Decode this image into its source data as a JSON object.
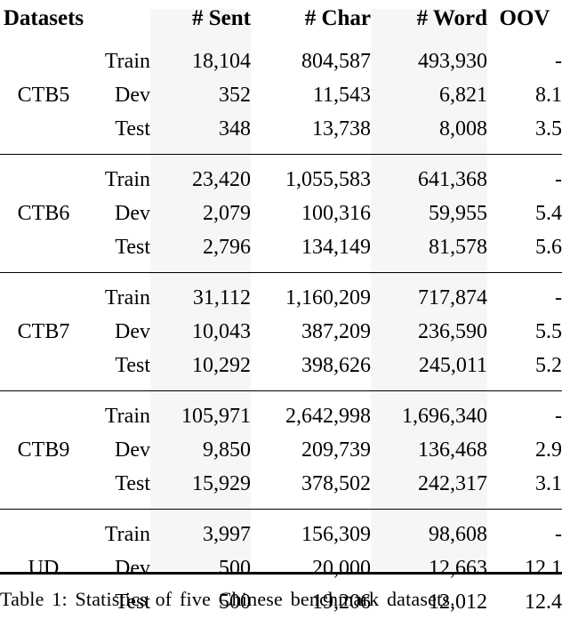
{
  "table": {
    "columns": [
      "Datasets",
      "",
      "# Sent",
      "# Char",
      "# Word",
      "OOV"
    ],
    "headers": {
      "datasets": "Datasets",
      "split": "",
      "sent": "# Sent",
      "char": "# Char",
      "word": "# Word",
      "oov": "OOV"
    },
    "blocks": [
      {
        "dataset": "CTB5",
        "rows": [
          {
            "split": "Train",
            "sent": "18,104",
            "char": "804,587",
            "word": "493,930",
            "oov": "-"
          },
          {
            "split": "Dev",
            "sent": "352",
            "char": "11,543",
            "word": "6,821",
            "oov": "8.1"
          },
          {
            "split": "Test",
            "sent": "348",
            "char": "13,738",
            "word": "8,008",
            "oov": "3.5"
          }
        ]
      },
      {
        "dataset": "CTB6",
        "rows": [
          {
            "split": "Train",
            "sent": "23,420",
            "char": "1,055,583",
            "word": "641,368",
            "oov": "-"
          },
          {
            "split": "Dev",
            "sent": "2,079",
            "char": "100,316",
            "word": "59,955",
            "oov": "5.4"
          },
          {
            "split": "Test",
            "sent": "2,796",
            "char": "134,149",
            "word": "81,578",
            "oov": "5.6"
          }
        ]
      },
      {
        "dataset": "CTB7",
        "rows": [
          {
            "split": "Train",
            "sent": "31,112",
            "char": "1,160,209",
            "word": "717,874",
            "oov": "-"
          },
          {
            "split": "Dev",
            "sent": "10,043",
            "char": "387,209",
            "word": "236,590",
            "oov": "5.5"
          },
          {
            "split": "Test",
            "sent": "10,292",
            "char": "398,626",
            "word": "245,011",
            "oov": "5.2"
          }
        ]
      },
      {
        "dataset": "CTB9",
        "rows": [
          {
            "split": "Train",
            "sent": "105,971",
            "char": "2,642,998",
            "word": "1,696,340",
            "oov": "-"
          },
          {
            "split": "Dev",
            "sent": "9,850",
            "char": "209,739",
            "word": "136,468",
            "oov": "2.9"
          },
          {
            "split": "Test",
            "sent": "15,929",
            "char": "378,502",
            "word": "242,317",
            "oov": "3.1"
          }
        ]
      },
      {
        "dataset": "UD",
        "rows": [
          {
            "split": "Train",
            "sent": "3,997",
            "char": "156,309",
            "word": "98,608",
            "oov": "-"
          },
          {
            "split": "Dev",
            "sent": "500",
            "char": "20,000",
            "word": "12,663",
            "oov": "12.1"
          },
          {
            "split": "Test",
            "sent": "500",
            "char": "19,206",
            "word": "12,012",
            "oov": "12.4"
          }
        ]
      }
    ]
  },
  "caption": {
    "text": "Table 1: Statistics of five Chinese benchmark datasets."
  },
  "colors": {
    "rule": "#000000",
    "shade": "#f6f6f6",
    "text": "#000000",
    "background": "#ffffff"
  }
}
